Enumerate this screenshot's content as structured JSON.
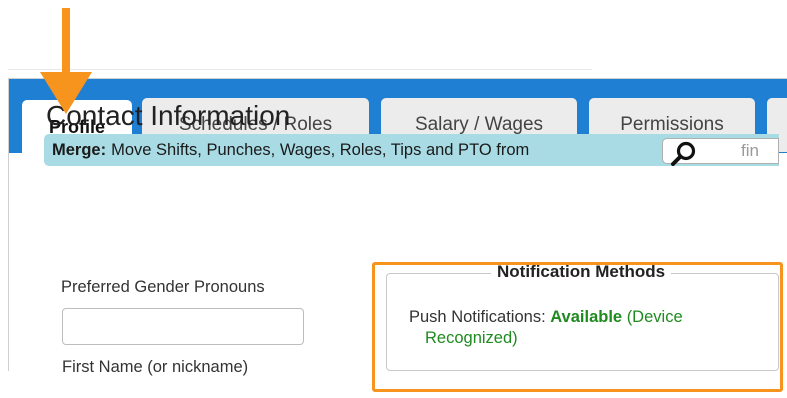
{
  "tabs": [
    {
      "label": "Profile",
      "active": true
    },
    {
      "label": "Schedules / Roles",
      "active": false
    },
    {
      "label": "Salary / Wages",
      "active": false
    },
    {
      "label": "Permissions",
      "active": false
    }
  ],
  "contact": {
    "title": "Contact Information"
  },
  "merge": {
    "bold_label": "Merge:",
    "text": "Move Shifts, Punches, Wages, Roles, Tips and PTO from",
    "search_placeholder": "fin"
  },
  "form": {
    "pronouns_label": "Preferred Gender Pronouns",
    "pronouns_value": "",
    "first_name_label": "First Name (or nickname)"
  },
  "notifications": {
    "legend": "Notification Methods",
    "push_label": "Push Notifications:",
    "push_status": "Available",
    "push_detail_1": "(Device",
    "push_detail_2": "Recognized)"
  },
  "colors": {
    "tabbar": "#1f7fd3",
    "merge_bar": "#a9dbe5",
    "available_green": "#1f8a1f",
    "annotation_orange": "#f7941d"
  },
  "icons": {
    "search": "magnifier-icon",
    "arrow": "down-arrow-annotation-icon"
  }
}
